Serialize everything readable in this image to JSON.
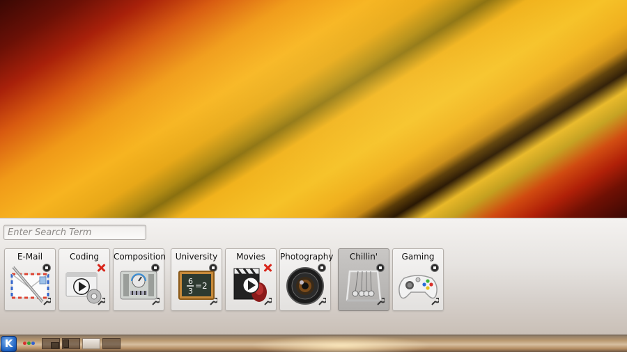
{
  "search": {
    "placeholder": "Enter Search Term"
  },
  "activities": [
    {
      "label": "E-Mail",
      "icon": "mail-icon",
      "control": "stop"
    },
    {
      "label": "Coding",
      "icon": "coding-icon",
      "control": "remove"
    },
    {
      "label": "Composition",
      "icon": "composition-icon",
      "control": "stop"
    },
    {
      "label": "University",
      "icon": "university-icon",
      "control": "stop"
    },
    {
      "label": "Movies",
      "icon": "movies-icon",
      "control": "remove"
    },
    {
      "label": "Photography",
      "icon": "camera-icon",
      "control": "stop"
    },
    {
      "label": "Chillin'",
      "icon": "newtons-cradle-icon",
      "control": "stop",
      "selected": true
    },
    {
      "label": "Gaming",
      "icon": "gamepad-icon",
      "control": "stop"
    }
  ],
  "university_icon_text": {
    "numerator": "6",
    "denominator": "3",
    "result": "=2"
  },
  "taskbar": {
    "kmenu_glyph": "K",
    "pager_count": 4,
    "active_desktop": 3
  },
  "colors": {
    "accent_blue": "#1b5fbf",
    "remove_red": "#d8251a",
    "gamepad_green": "#3cb43c",
    "gamepad_red": "#d8302a",
    "gamepad_blue": "#2a6bd8",
    "gamepad_yellow": "#e8c020"
  }
}
